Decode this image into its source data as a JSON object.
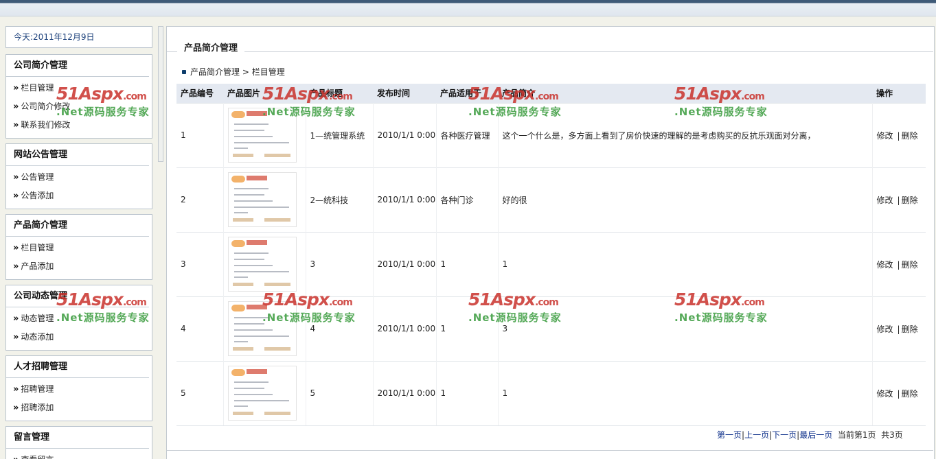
{
  "today": "今天:2011年12月9日",
  "sidebar": {
    "groups": [
      {
        "title": "公司简介管理",
        "items": [
          "栏目管理",
          "公司简介修改",
          "联系我们修改"
        ]
      },
      {
        "title": "网站公告管理",
        "items": [
          "公告管理",
          "公告添加"
        ]
      },
      {
        "title": "产品简介管理",
        "items": [
          "栏目管理",
          "产品添加"
        ]
      },
      {
        "title": "公司动态管理",
        "items": [
          "动态管理",
          "动态添加"
        ]
      },
      {
        "title": "人才招聘管理",
        "items": [
          "招聘管理",
          "招聘添加"
        ]
      },
      {
        "title": "留言管理",
        "items": [
          "查看留言"
        ]
      }
    ],
    "bullet": "»"
  },
  "main": {
    "legend": "产品简介管理",
    "breadcrumb": {
      "root": "产品简介管理",
      "sep": " > ",
      "current": "栏目管理"
    },
    "table": {
      "headers": [
        "产品编号",
        "产品图片",
        "产品标题",
        "发布时间",
        "产品适用于",
        "产品简介",
        "操作"
      ],
      "rows": [
        {
          "id": "1",
          "title": "1—统管理系统",
          "date": "2010/1/1 0:00",
          "for": "各种医疗管理",
          "desc": "这个一个什么是，多方面上看到了房价快速的理解的是考虑购买的反抗乐观面对分离，"
        },
        {
          "id": "2",
          "title": "2—统科技",
          "date": "2010/1/1 0:00",
          "for": "各种门诊",
          "desc": "好的很"
        },
        {
          "id": "3",
          "title": "3",
          "date": "2010/1/1 0:00",
          "for": "1",
          "desc": "1"
        },
        {
          "id": "4",
          "title": "4",
          "date": "2010/1/1 0:00",
          "for": "1",
          "desc": "3"
        },
        {
          "id": "5",
          "title": "5",
          "date": "2010/1/1 0:00",
          "for": "1",
          "desc": "1"
        }
      ],
      "edit_label": "修改",
      "sep_label": "|",
      "delete_label": "删除"
    },
    "pager": {
      "first": "第一页",
      "prev": "上一页",
      "next": "下一页",
      "last": "最后一页",
      "sep": "|",
      "current": "当前第1页",
      "total": "共3页"
    }
  },
  "watermark": {
    "brand": "51Aspx",
    "domain": ".com",
    "slogan": ".Net源码服务专家"
  }
}
